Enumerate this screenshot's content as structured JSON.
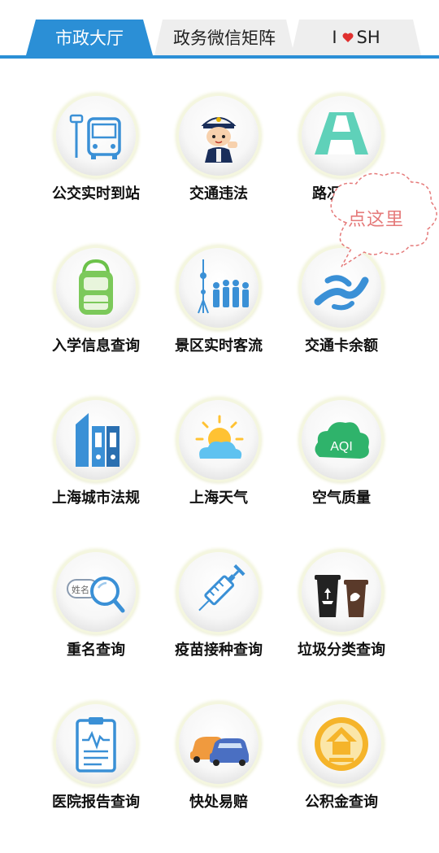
{
  "tabs": [
    {
      "label": "市政大厅",
      "active": true
    },
    {
      "label": "政务微信矩阵",
      "active": false
    },
    {
      "label_left": "I",
      "label_right": "SH",
      "active": false
    }
  ],
  "colors": {
    "accent": "#2b8fd6",
    "callout": "#e57a7a"
  },
  "callout": {
    "text": "点这里"
  },
  "services": [
    {
      "label": "公交实时到站",
      "icon": "bus-stop-icon"
    },
    {
      "label": "交通违法",
      "icon": "traffic-police-icon"
    },
    {
      "label": "路况查询",
      "icon": "road-icon"
    },
    {
      "label": "入学信息查询",
      "icon": "school-bag-icon"
    },
    {
      "label": "景区实时客流",
      "icon": "tourist-crowd-icon"
    },
    {
      "label": "交通卡余额",
      "icon": "transport-card-icon"
    },
    {
      "label": "上海城市法规",
      "icon": "law-books-icon"
    },
    {
      "label": "上海天气",
      "icon": "weather-icon"
    },
    {
      "label": "空气质量",
      "icon": "air-quality-icon"
    },
    {
      "label": "重名查询",
      "icon": "name-search-icon"
    },
    {
      "label": "疫苗接种查询",
      "icon": "vaccine-syringe-icon"
    },
    {
      "label": "垃圾分类查询",
      "icon": "garbage-bins-icon"
    },
    {
      "label": "医院报告查询",
      "icon": "medical-report-icon"
    },
    {
      "label": "快处易赔",
      "icon": "car-accident-icon"
    },
    {
      "label": "公积金查询",
      "icon": "housing-fund-icon"
    }
  ],
  "icon_text": {
    "aqi": "AQI",
    "name_tag": "姓名"
  }
}
